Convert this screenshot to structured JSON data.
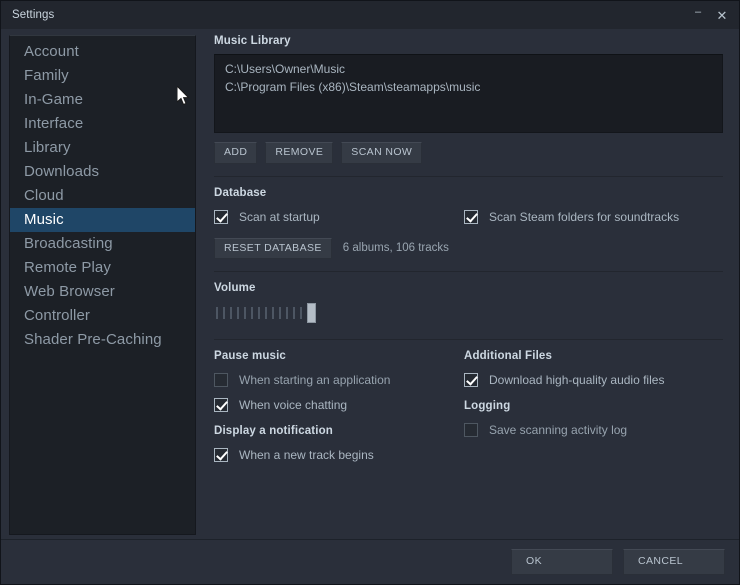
{
  "window": {
    "title": "Settings",
    "minimize_label": "–",
    "close_label": "✕"
  },
  "sidebar": {
    "items": [
      {
        "label": "Account",
        "active": false
      },
      {
        "label": "Family",
        "active": false
      },
      {
        "label": "In-Game",
        "active": false
      },
      {
        "label": "Interface",
        "active": false
      },
      {
        "label": "Library",
        "active": false
      },
      {
        "label": "Downloads",
        "active": false
      },
      {
        "label": "Cloud",
        "active": false
      },
      {
        "label": "Music",
        "active": true
      },
      {
        "label": "Broadcasting",
        "active": false
      },
      {
        "label": "Remote Play",
        "active": false
      },
      {
        "label": "Web Browser",
        "active": false
      },
      {
        "label": "Controller",
        "active": false
      },
      {
        "label": "Shader Pre-Caching",
        "active": false
      }
    ]
  },
  "music_library": {
    "title": "Music Library",
    "paths": [
      "C:\\Users\\Owner\\Music",
      "C:\\Program Files (x86)\\Steam\\steamapps\\music"
    ],
    "buttons": {
      "add": "ADD",
      "remove": "REMOVE",
      "scan_now": "SCAN NOW"
    }
  },
  "database": {
    "title": "Database",
    "scan_at_startup": {
      "label": "Scan at startup",
      "checked": true
    },
    "scan_steam_folders": {
      "label": "Scan Steam folders for soundtracks",
      "checked": true
    },
    "reset_button": "RESET DATABASE",
    "stats": "6 albums, 106 tracks"
  },
  "volume": {
    "title": "Volume",
    "tick_count": 14,
    "handle_position_percent": 88
  },
  "pause_music": {
    "title": "Pause music",
    "options": [
      {
        "label": "When starting an application",
        "checked": false
      },
      {
        "label": "When voice chatting",
        "checked": true
      }
    ]
  },
  "display_notification": {
    "title": "Display a notification",
    "options": [
      {
        "label": "When a new track begins",
        "checked": true
      }
    ]
  },
  "additional_files": {
    "title": "Additional Files",
    "options": [
      {
        "label": "Download high-quality audio files",
        "checked": true
      }
    ]
  },
  "logging": {
    "title": "Logging",
    "options": [
      {
        "label": "Save scanning activity log",
        "checked": false
      }
    ]
  },
  "footer": {
    "ok": "OK",
    "cancel": "CANCEL"
  },
  "colors": {
    "window_bg": "#2a2f3a",
    "sidebar_bg": "#1c2026",
    "accent_selected": "#1f4667",
    "listbox_bg": "#191c22",
    "text_primary": "#c6d4df",
    "text_muted": "#97a3ae"
  }
}
